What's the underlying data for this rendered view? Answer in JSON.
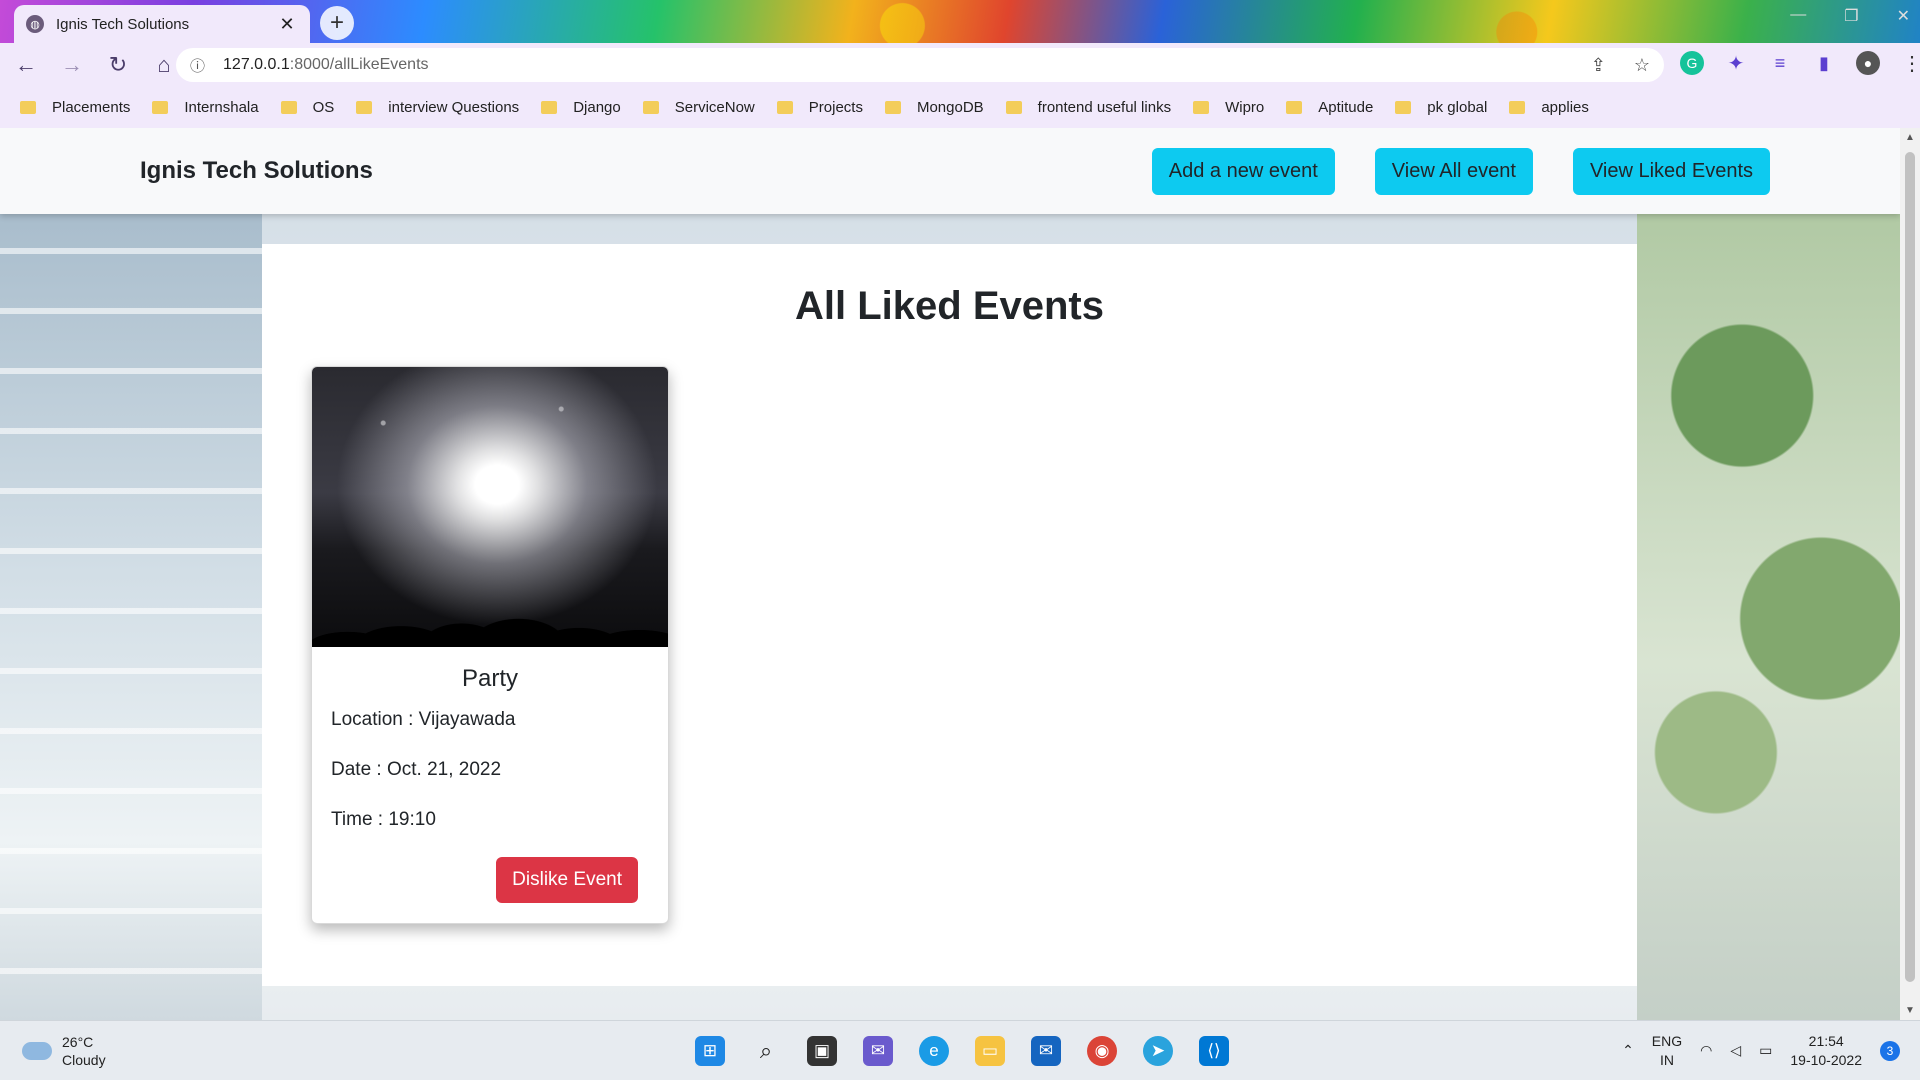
{
  "browser": {
    "tab_title": "Ignis Tech Solutions",
    "tab_close": "✕",
    "new_tab": "+",
    "url_host": "127.0.0.1",
    "url_path": ":8000/allLikeEvents",
    "bookmarks": [
      "Placements",
      "Internshala",
      "OS",
      "interview Questions",
      "Django",
      "ServiceNow",
      "Projects",
      "MongoDB",
      "frontend useful links",
      "Wipro",
      "Aptitude",
      "pk global",
      "applies"
    ]
  },
  "navbar": {
    "brand": "Ignis Tech Solutions",
    "buttons": [
      "Add a new event",
      "View All event",
      "View Liked Events"
    ]
  },
  "main": {
    "title": "All Liked Events",
    "card": {
      "title": "Party",
      "location": "Location : Vijayawada",
      "date": "Date : Oct. 21, 2022",
      "time": "Time : 19:10",
      "button": "Dislike Event"
    }
  },
  "taskbar": {
    "temp": "26°C",
    "weather": "Cloudy",
    "lang_top": "ENG",
    "lang_bottom": "IN",
    "clock_time": "21:54",
    "clock_date": "19-10-2022",
    "notification_count": "3"
  },
  "colors": {
    "info": "#0dcaf0",
    "danger": "#dc3545"
  }
}
